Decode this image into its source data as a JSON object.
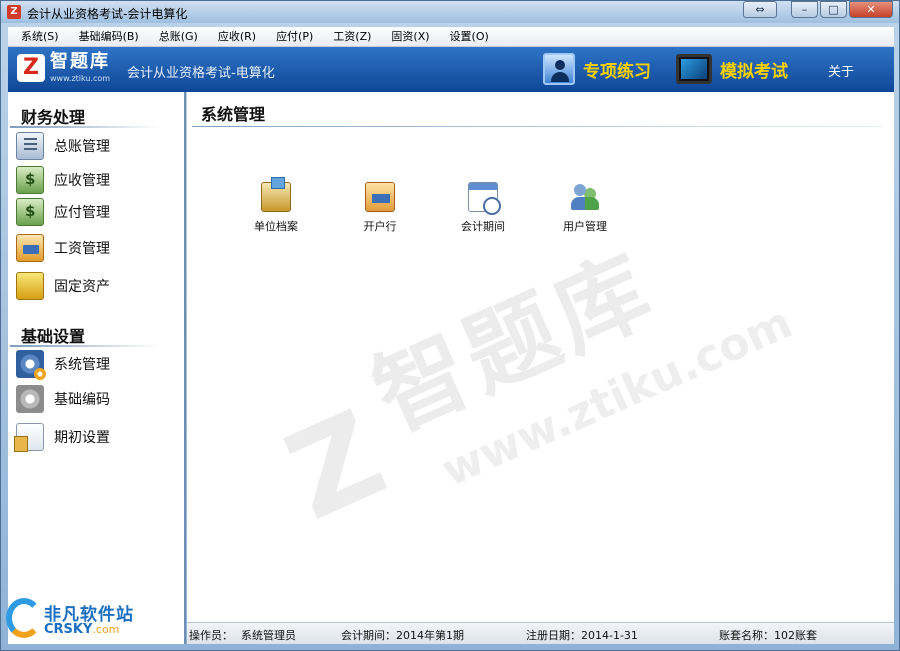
{
  "window": {
    "title": "会计从业资格考试-会计电算化"
  },
  "menu": [
    "系统(S)",
    "基础编码(B)",
    "总账(G)",
    "应收(R)",
    "应付(P)",
    "工资(Z)",
    "固资(X)",
    "设置(O)"
  ],
  "banner": {
    "logo_mark": "Z",
    "logo_text": "智题库",
    "logo_url": "www.ztiku.com",
    "subtitle": "会计从业资格考试-电算化",
    "practice_label": "专项练习",
    "exam_label": "模拟考试",
    "about_label": "关于"
  },
  "sidebar": {
    "section1": "财务处理",
    "items1": [
      "总账管理",
      "应收管理",
      "应付管理",
      "工资管理",
      "固定资产"
    ],
    "section2": "基础设置",
    "items2": [
      "系统管理",
      "基础编码",
      "期初设置"
    ]
  },
  "main": {
    "title": "系统管理",
    "tools": [
      "单位档案",
      "开户行",
      "会计期间",
      "用户管理"
    ]
  },
  "watermark": {
    "brand": "智题库",
    "url": "www.ztiku.com"
  },
  "status": {
    "operator_label": "操作员：",
    "operator": "系统管理员",
    "period_label": "会计期间：",
    "period": "2014年第1期",
    "regdate_label": "注册日期：",
    "regdate": "2014-1-31",
    "account_label": "账套名称：",
    "account": "102账套"
  },
  "corner": {
    "title": "非凡软件站",
    "sub1": "CRSKY",
    "sub2": ".com"
  }
}
